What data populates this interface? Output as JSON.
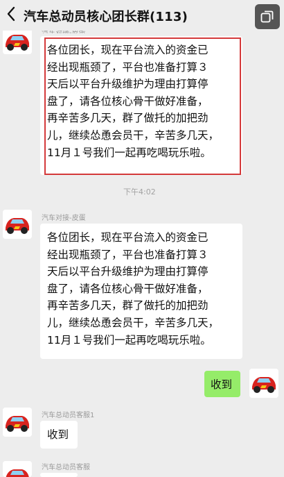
{
  "header": {
    "title": "汽车总动员核心团长群(113)",
    "back_icon": "chevron-left-icon",
    "menu_icon": "chat-info-icon"
  },
  "messages": [
    {
      "sender": "汽车对接-皮蛋",
      "text": "各位团长，现在平台流入的资金已\n经出现瓶颈了，平台也准备打算３\n天后以平台升级维护为理由打算停\n盘了，请各位核心骨干做好准备，\n再辛苦多几天，群了做托的加把劲\n儿，继续怂恿会员干，辛苦多几天，\n11月１号我们一起再吃喝玩乐啦。",
      "highlighted": true
    },
    {
      "timestamp": "下午4:02"
    },
    {
      "sender": "汽车对接-皮蛋",
      "text": "各位团长，现在平台流入的资金已\n经出现瓶颈了，平台也准备打算３\n天后以平台升级维护为理由打算停\n盘了，请各位核心骨干做好准备，\n再辛苦多几天，群了做托的加把劲\n儿，继续怂恿会员干，辛苦多几天，\n11月１号我们一起再吃喝玩乐啦。"
    },
    {
      "self": true,
      "text": "收到"
    },
    {
      "sender": "汽车总动员客服1",
      "text": "收到"
    },
    {
      "sender": "汽车总动员客服"
    }
  ],
  "colors": {
    "background": "#ededed",
    "bubble_in": "#ffffff",
    "bubble_out": "#95ec69",
    "highlight_border": "#d4393a"
  }
}
